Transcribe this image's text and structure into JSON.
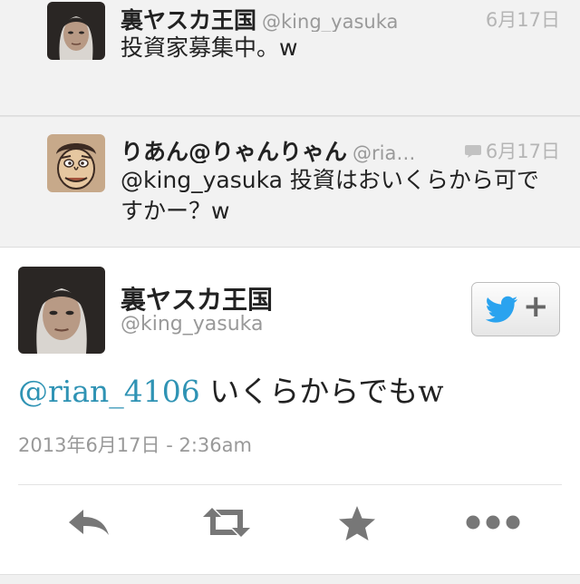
{
  "thread": [
    {
      "display_name": "裏ヤスカ王国",
      "screen_name": "@king_yasuka",
      "time": "6月17日",
      "text": "投資家募集中。w",
      "avatar_icon": "user-photo-avatar"
    },
    {
      "display_name": "りあん@りゃんりゃん",
      "screen_name": "@ria…",
      "time": "6月17日",
      "text": "@king_yasuka 投資はおいくらから可ですかー？w",
      "avatar_icon": "cartoon-face-avatar"
    }
  ],
  "main_tweet": {
    "display_name": "裏ヤスカ王国",
    "screen_name": "@king_yasuka",
    "mention": "@rian_4106",
    "text": " いくらからでもw",
    "timestamp": "2013年6月17日 - 2:36am",
    "follow_plus": "+"
  },
  "actions": [
    "reply-icon",
    "retweet-icon",
    "favorite-star-icon",
    "more-dots-icon"
  ],
  "colors": {
    "accent": "#2f93b4",
    "twitter_blue": "#2aa3ef",
    "muted": "#999999",
    "thread_bg": "#f2f2f2",
    "icon_gray": "#777777"
  }
}
